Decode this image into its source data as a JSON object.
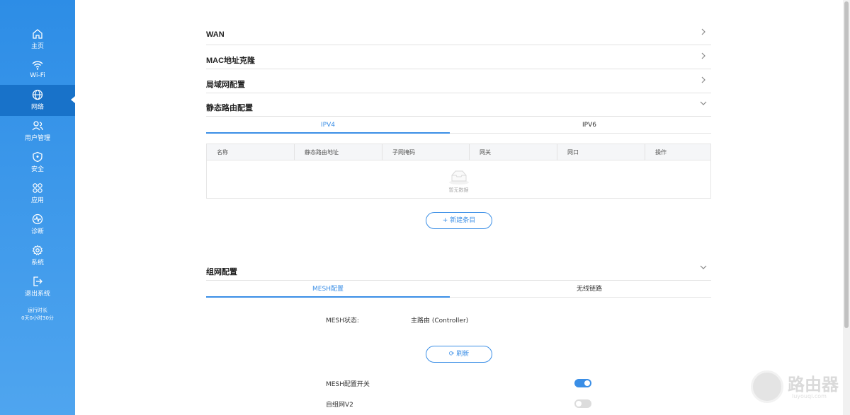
{
  "sidebar": {
    "items": [
      {
        "label": "主页",
        "icon": "home-icon"
      },
      {
        "label": "Wi-Fi",
        "icon": "wifi-icon"
      },
      {
        "label": "网络",
        "icon": "globe-icon",
        "active": true
      },
      {
        "label": "用户管理",
        "icon": "users-icon"
      },
      {
        "label": "安全",
        "icon": "shield-icon"
      },
      {
        "label": "应用",
        "icon": "apps-icon"
      },
      {
        "label": "诊断",
        "icon": "pulse-icon"
      },
      {
        "label": "系统",
        "icon": "gear-icon"
      },
      {
        "label": "退出系统",
        "icon": "logout-icon"
      }
    ],
    "uptime_label": "运行时长",
    "uptime_value": "0天0小时30分"
  },
  "sections": {
    "wan": "WAN",
    "mac_clone": "MAC地址克隆",
    "lan_config": "局域网配置",
    "static_route": "静态路由配置",
    "mesh_network": "组网配置"
  },
  "route_tabs": {
    "ipv4": "IPV4",
    "ipv6": "IPV6"
  },
  "route_table": {
    "columns": [
      "名称",
      "静态路由地址",
      "子网掩码",
      "网关",
      "网口",
      "操作"
    ],
    "empty_text": "暂无数据"
  },
  "add_entry_button": "新建条目",
  "mesh_tabs": {
    "mesh_config": "MESH配置",
    "wireless_link": "无线链路"
  },
  "mesh": {
    "status_label": "MESH状态:",
    "status_value": "主路由 (Controller)",
    "refresh_button": "刷新",
    "switch_label": "MESH配置开关",
    "switch_on": true,
    "v2_label": "自组网V2",
    "v2_on": false
  },
  "watermark": {
    "title": "路由器",
    "subtitle": "luyouqi.com"
  },
  "colors": {
    "accent": "#3a8ee6",
    "sidebar": "#2d8de6",
    "sidebar_active": "#1872c9"
  }
}
